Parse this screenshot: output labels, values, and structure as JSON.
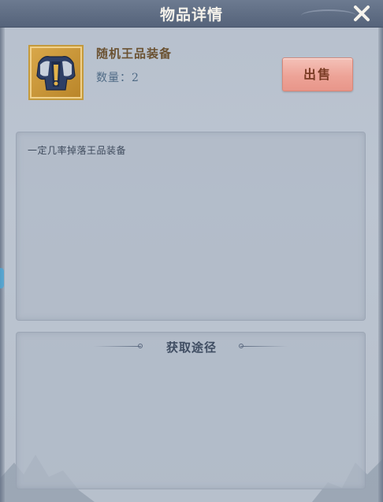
{
  "window": {
    "title": "物品详情",
    "close_icon": "close-x-icon"
  },
  "item": {
    "icon": "armor-equipment-icon",
    "name": "随机王品装备",
    "quantity": "数量：2",
    "description": "一定几率掉落王品装备"
  },
  "actions": {
    "sell_label": "出售"
  },
  "source": {
    "title": "获取途径"
  },
  "colors": {
    "title_bar": "#5f6d83",
    "panel_bg": "#bac3cf",
    "item_name": "#6b5232",
    "sell_button": "#eda397",
    "icon_frame": "#c49a3c"
  }
}
